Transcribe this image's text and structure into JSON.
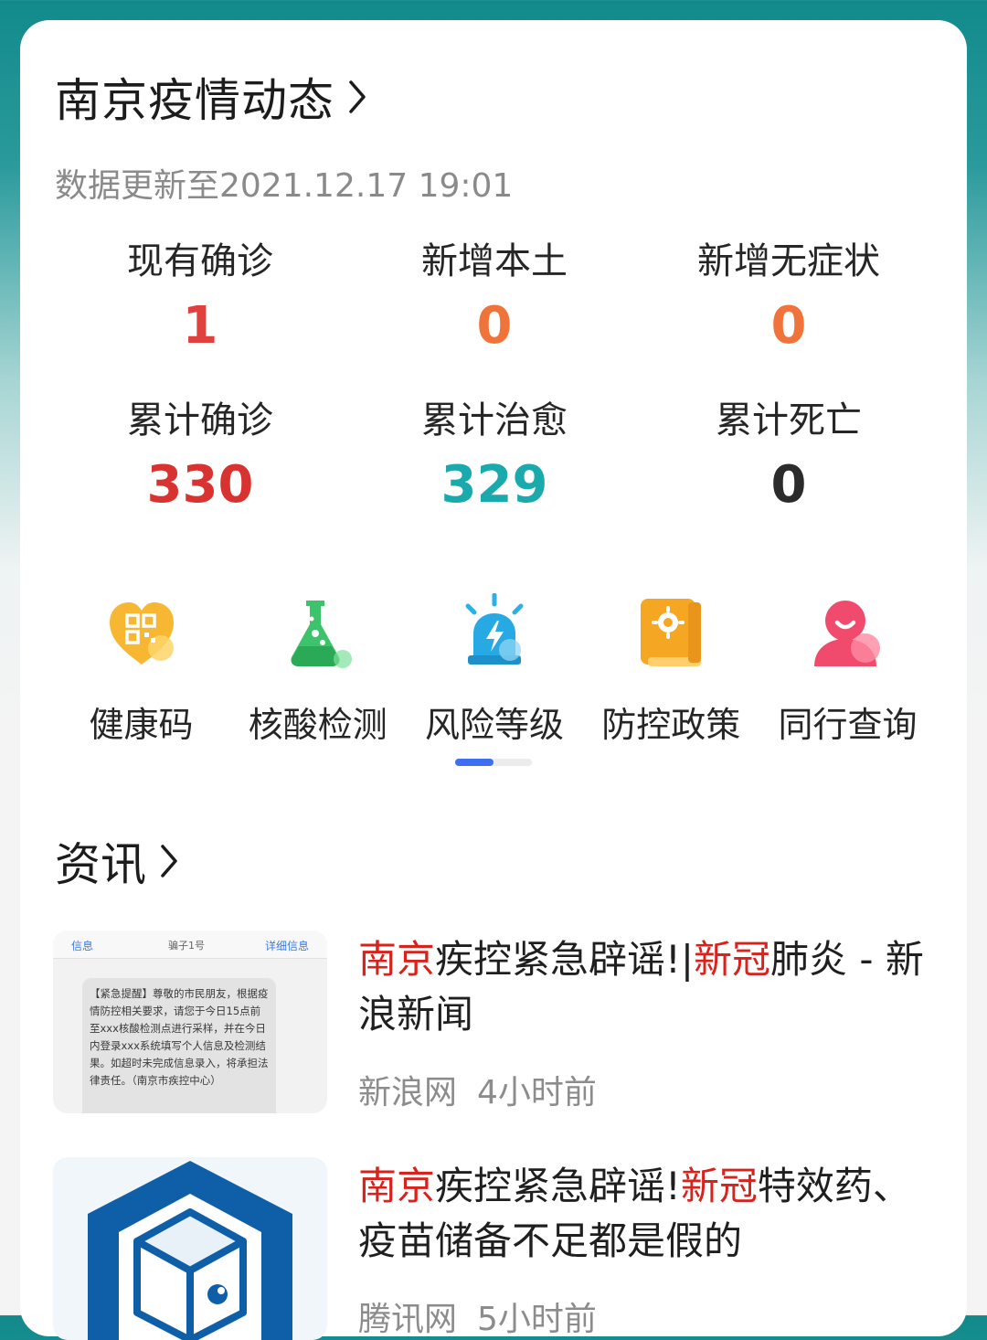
{
  "header": {
    "title": "南京疫情动态",
    "update_text": "数据更新至2021.12.17 19:01"
  },
  "stats": [
    {
      "label": "现有确诊",
      "value": "1",
      "color": "#e0413f"
    },
    {
      "label": "新增本土",
      "value": "0",
      "color": "#f0743a"
    },
    {
      "label": "新增无症状",
      "value": "0",
      "color": "#f0743a"
    },
    {
      "label": "累计确诊",
      "value": "330",
      "color": "#d93331"
    },
    {
      "label": "累计治愈",
      "value": "329",
      "color": "#1aa9ad"
    },
    {
      "label": "累计死亡",
      "value": "0",
      "color": "#2b2b2b"
    }
  ],
  "services": [
    {
      "label": "健康码",
      "icon": "health-code-icon"
    },
    {
      "label": "核酸检测",
      "icon": "flask-icon"
    },
    {
      "label": "风险等级",
      "icon": "alarm-icon"
    },
    {
      "label": "防控政策",
      "icon": "policy-book-icon"
    },
    {
      "label": "同行查询",
      "icon": "companion-icon"
    }
  ],
  "news": {
    "title": "资讯",
    "items": [
      {
        "headline_parts": [
          {
            "text": "南京",
            "highlight": true
          },
          {
            "text": "疾控紧急辟谣!|",
            "highlight": false
          },
          {
            "text": "新冠",
            "highlight": true
          },
          {
            "text": "肺炎 - 新浪新闻",
            "highlight": false
          }
        ],
        "source": "新浪网",
        "time": "4小时前",
        "thumb": {
          "back": "信息",
          "contact": "骗子1号",
          "detail": "详细信息",
          "message": "【紧急提醒】尊敬的市民朋友，根据疫情防控相关要求，请您于今日15点前至xxx核酸检测点进行采样，并在今日内登录xxx系统填写个人信息及检测结果。如超时未完成信息录入，将承担法律责任。（南京市疾控中心）"
        }
      },
      {
        "headline_parts": [
          {
            "text": "南京",
            "highlight": true
          },
          {
            "text": "疾控紧急辟谣!",
            "highlight": false
          },
          {
            "text": "新冠",
            "highlight": true
          },
          {
            "text": "特效药、疫苗储备不足都是假的",
            "highlight": false
          }
        ],
        "source": "腾讯网",
        "time": "5小时前"
      }
    ]
  },
  "colors": {
    "highlight": "#d8221c",
    "indicator_active": "#3d6ff0",
    "header_teal": "#128a8c"
  }
}
